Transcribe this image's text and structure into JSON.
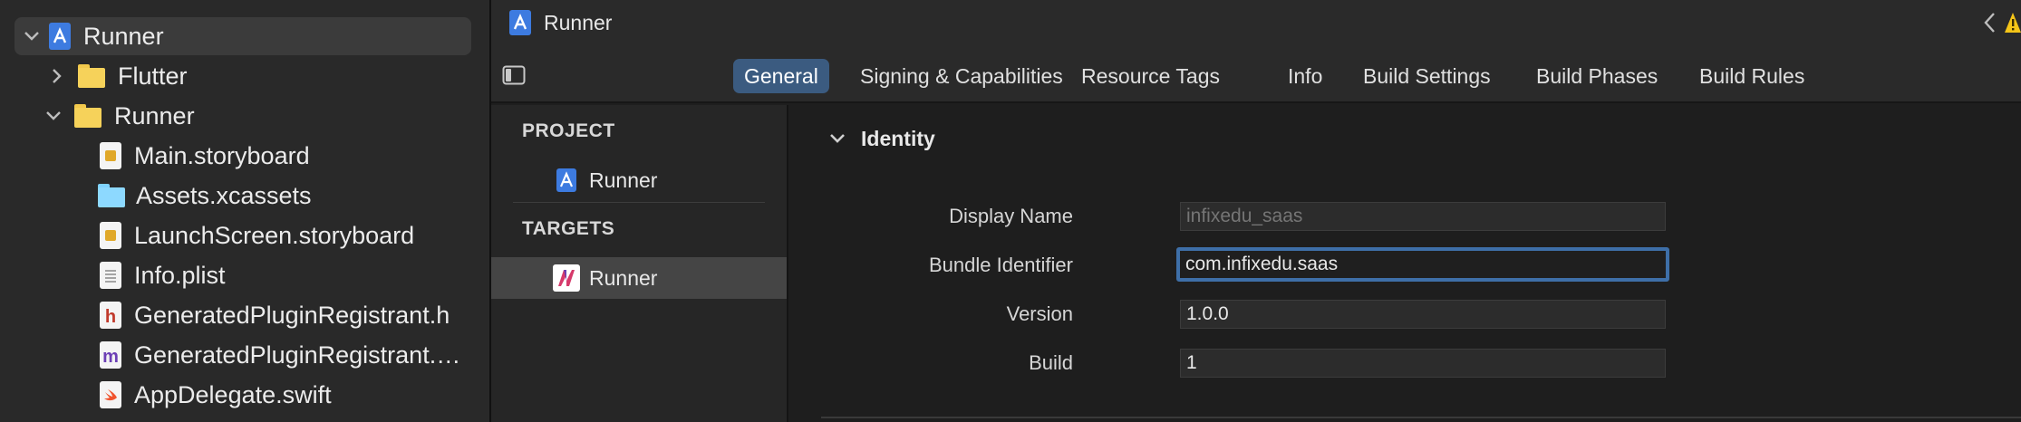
{
  "navigator": {
    "items": [
      {
        "label": "Runner",
        "kind": "project",
        "expanded": true,
        "selected": true
      },
      {
        "label": "Flutter",
        "kind": "folder",
        "expanded": false
      },
      {
        "label": "Runner",
        "kind": "folder",
        "expanded": true
      },
      {
        "label": "Main.storyboard",
        "kind": "storyboard"
      },
      {
        "label": "Assets.xcassets",
        "kind": "assets"
      },
      {
        "label": "LaunchScreen.storyboard",
        "kind": "storyboard"
      },
      {
        "label": "Info.plist",
        "kind": "plist"
      },
      {
        "label": "GeneratedPluginRegistrant.h",
        "kind": "header",
        "badge": "h"
      },
      {
        "label": "GeneratedPluginRegistrant.…",
        "kind": "objc",
        "badge": "m"
      },
      {
        "label": "AppDelegate.swift",
        "kind": "swift"
      }
    ]
  },
  "editor": {
    "title": "Runner",
    "tabs": [
      {
        "label": "General",
        "active": true
      },
      {
        "label": "Signing & Capabilities"
      },
      {
        "label": "Resource Tags"
      },
      {
        "label": "Info"
      },
      {
        "label": "Build Settings"
      },
      {
        "label": "Build Phases"
      },
      {
        "label": "Build Rules"
      }
    ]
  },
  "targets_pane": {
    "project_header": "PROJECT",
    "project_item": "Runner",
    "targets_header": "TARGETS",
    "target_item": "Runner"
  },
  "identity": {
    "section_title": "Identity",
    "fields": {
      "display_name": {
        "label": "Display Name",
        "placeholder": "infixedu_saas",
        "value": ""
      },
      "bundle_identifier": {
        "label": "Bundle Identifier",
        "value": "com.infixedu.saas"
      },
      "version": {
        "label": "Version",
        "value": "1.0.0"
      },
      "build": {
        "label": "Build",
        "value": "1"
      }
    }
  },
  "colors": {
    "accent": "#3b5b80",
    "focus_ring": "#3e6fa8",
    "folder": "#f6d25a",
    "warning": "#f5c518"
  }
}
